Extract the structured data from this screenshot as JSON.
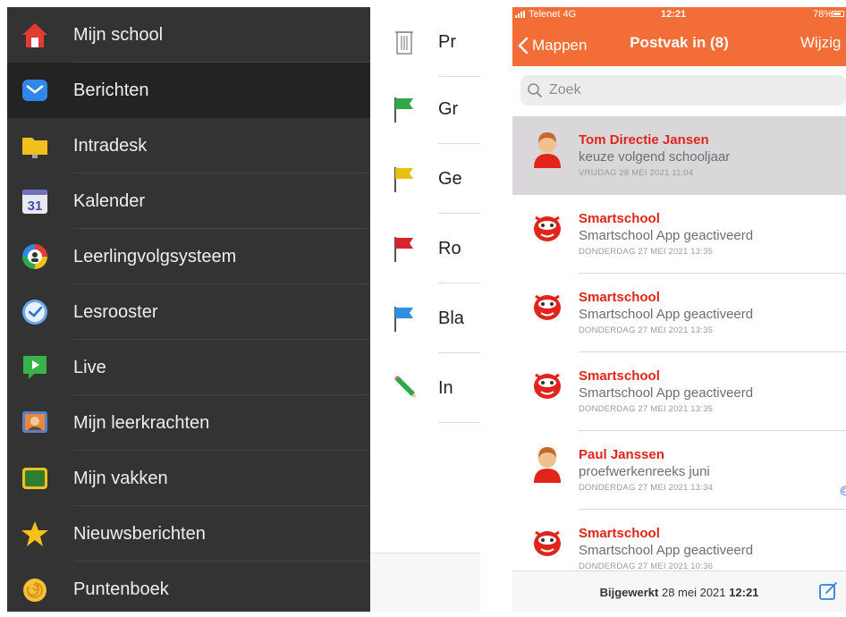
{
  "sidebar": {
    "active_index": 1,
    "items": [
      {
        "label": "Mijn school",
        "icon": "house-icon"
      },
      {
        "label": "Berichten",
        "icon": "envelope-icon"
      },
      {
        "label": "Intradesk",
        "icon": "folder-icon"
      },
      {
        "label": "Kalender",
        "icon": "calendar-icon",
        "icon_text": "31"
      },
      {
        "label": "Leerlingvolgsysteem",
        "icon": "student-tracking-icon"
      },
      {
        "label": "Lesrooster",
        "icon": "clock-icon"
      },
      {
        "label": "Live",
        "icon": "live-video-icon"
      },
      {
        "label": "Mijn leerkrachten",
        "icon": "teacher-board-icon"
      },
      {
        "label": "Mijn vakken",
        "icon": "chalkboard-icon"
      },
      {
        "label": "Nieuwsberichten",
        "icon": "star-icon"
      },
      {
        "label": "Puntenboek",
        "icon": "shell-icon"
      }
    ]
  },
  "flags": {
    "items": [
      {
        "label": "Pr",
        "icon": "trash-icon"
      },
      {
        "label": "Gr",
        "icon": "green-flag-icon",
        "color": "#2ea84a"
      },
      {
        "label": "Ge",
        "icon": "yellow-flag-icon",
        "color": "#e6c20e"
      },
      {
        "label": "Ro",
        "icon": "red-flag-icon",
        "color": "#d8232a"
      },
      {
        "label": "Bla",
        "icon": "blue-flag-icon",
        "color": "#2f8fe0"
      },
      {
        "label": "In",
        "icon": "pencil-icon"
      }
    ]
  },
  "phone": {
    "status": {
      "carrier": "Telenet  4G",
      "time": "12:21",
      "battery": "78%"
    },
    "nav": {
      "back_label": "Mappen",
      "title": "Postvak in (8)",
      "edit_label": "Wijzig"
    },
    "search": {
      "placeholder": "Zoek"
    },
    "messages": [
      {
        "from": "Tom Directie Jansen",
        "subject": "keuze volgend schooljaar",
        "date": "VRIJDAG 28 MEI 2021 11:04",
        "avatar": "person-avatar-icon",
        "selected": true
      },
      {
        "from": "Smartschool",
        "subject": "Smartschool App geactiveerd",
        "date": "DONDERDAG 27 MEI 2021 13:35",
        "avatar": "smartschool-mascot-icon"
      },
      {
        "from": "Smartschool",
        "subject": "Smartschool App geactiveerd",
        "date": "DONDERDAG 27 MEI 2021 13:35",
        "avatar": "smartschool-mascot-icon"
      },
      {
        "from": "Smartschool",
        "subject": "Smartschool App geactiveerd",
        "date": "DONDERDAG 27 MEI 2021 13:35",
        "avatar": "smartschool-mascot-icon"
      },
      {
        "from": "Paul Janssen",
        "subject": "proefwerkenreeks juni",
        "date": "DONDERDAG 27 MEI 2021 13:34",
        "avatar": "person-avatar-icon",
        "attachment": "@"
      },
      {
        "from": "Smartschool",
        "subject": "Smartschool App geactiveerd",
        "date": "DONDERDAG 27 MEI 2021 10:36",
        "avatar": "smartschool-mascot-icon"
      }
    ],
    "footer": {
      "updated_label": "Bijgewerkt",
      "updated_date": "28 mei 2021",
      "updated_time": "12:21"
    },
    "colors": {
      "accent": "#f26e36",
      "sender": "#e1251b"
    }
  }
}
